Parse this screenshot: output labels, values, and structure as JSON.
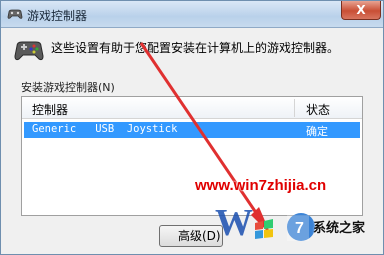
{
  "window": {
    "title": "游戏控制器",
    "close_glyph": "X"
  },
  "description": "这些设置有助于您配置安装在计算机上的游戏控制器。",
  "installed_label": "安装游戏控制器(N)",
  "list": {
    "columns": [
      "控制器",
      "状态"
    ],
    "rows": [
      {
        "name": "Generic   USB  Joystick",
        "status": "确定"
      }
    ]
  },
  "buttons": {
    "advanced_label": "高级(D)"
  },
  "watermark": {
    "url": "www.win7zhijia.cn",
    "brand": "系统之家",
    "brand_color": "#e00000"
  },
  "colors": {
    "selection": "#3399ff",
    "arrow": "#e03030"
  }
}
